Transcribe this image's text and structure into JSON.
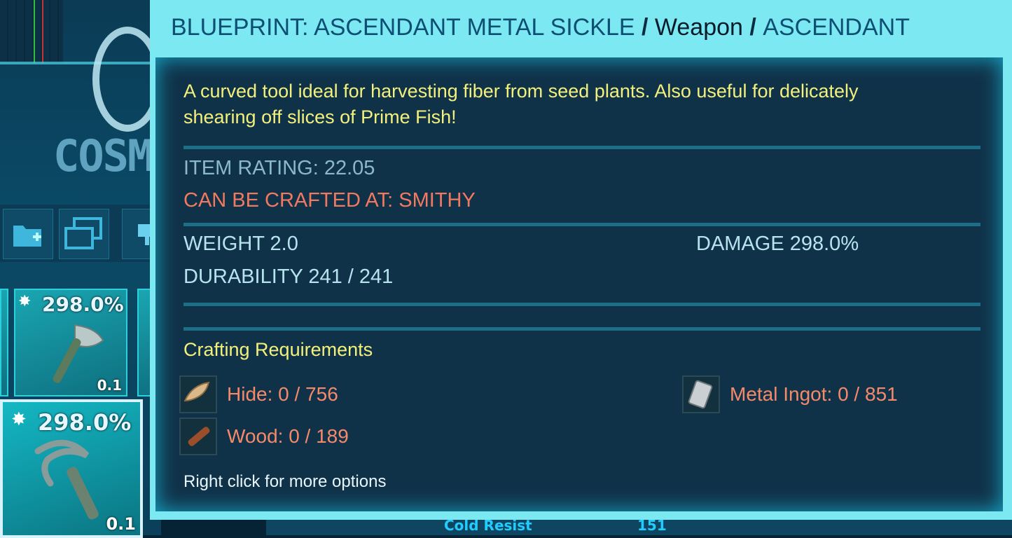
{
  "background": {
    "left_label": "COSM",
    "bottom_row_label": "Cold Resist",
    "bottom_row_value": "151"
  },
  "inventory": {
    "slots": [
      {
        "damage": "298.0%",
        "weight": "0.1",
        "tool": "hatchet"
      },
      {
        "damage": "298.0%",
        "weight": "0.1",
        "tool": "sickle",
        "selected": true
      }
    ]
  },
  "tooltip": {
    "title_item": "BLUEPRINT: ASCENDANT METAL SICKLE",
    "title_sep1": " / ",
    "title_type": "Weapon",
    "title_sep2": " / ",
    "title_quality": "ASCENDANT",
    "description": "A curved tool ideal for harvesting fiber from seed plants. Also useful for delicately shearing off slices of Prime Fish!",
    "item_rating": "ITEM RATING: 22.05",
    "crafted_at": "CAN BE CRAFTED AT: SMITHY",
    "weight": "WEIGHT 2.0",
    "damage": "DAMAGE 298.0%",
    "durability": "DURABILITY 241 / 241",
    "requirements_title": "Crafting Requirements",
    "requirements": [
      {
        "label": "Hide: 0 / 756",
        "icon": "hide-icon"
      },
      {
        "label": "Wood: 0 / 189",
        "icon": "wood-icon"
      },
      {
        "label": "Metal Ingot: 0 / 851",
        "icon": "metal-ingot-icon"
      }
    ],
    "hint": "Right click for more options"
  },
  "colors": {
    "title_bar": "#7be8f2",
    "description": "#f3f07c",
    "crafted_warning": "#f2795f",
    "requirement_missing": "#f48a6a"
  }
}
